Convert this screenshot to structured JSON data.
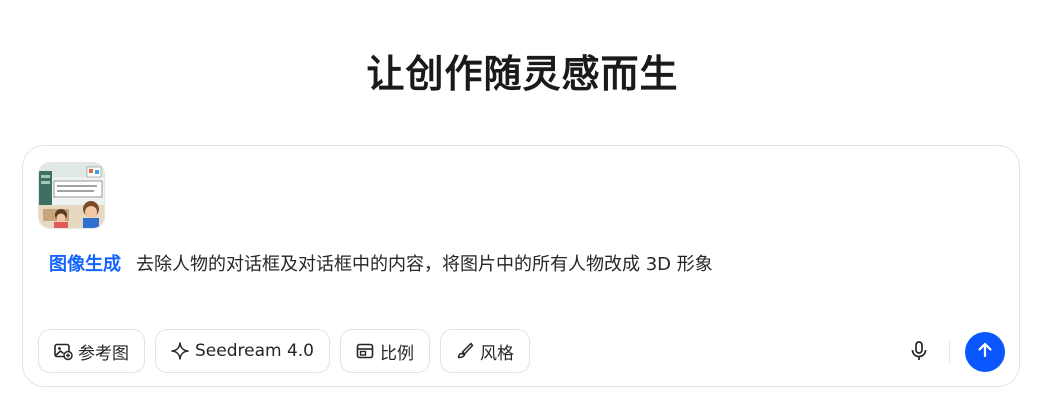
{
  "headline": "让创作随灵感而生",
  "composer": {
    "mode_tag": "图像生成",
    "prompt": "去除人物的对话框及对话框中的内容，将图片中的所有人物改成 3D 形象",
    "reference_thumbnail_icon": "reference-image-thumbnail"
  },
  "toolbar": {
    "reference_label": "参考图",
    "reference_icon": "image-add-icon",
    "model_label": "Seedream 4.0",
    "model_icon": "sparkle-icon",
    "ratio_label": "比例",
    "ratio_icon": "layout-icon",
    "style_label": "风格",
    "style_icon": "brush-icon"
  },
  "actions": {
    "mic_icon": "microphone-icon",
    "send_icon": "arrow-up-icon"
  },
  "colors": {
    "accent": "#1664ff",
    "send_button": "#0b57ff",
    "border": "#e3e3e6"
  }
}
